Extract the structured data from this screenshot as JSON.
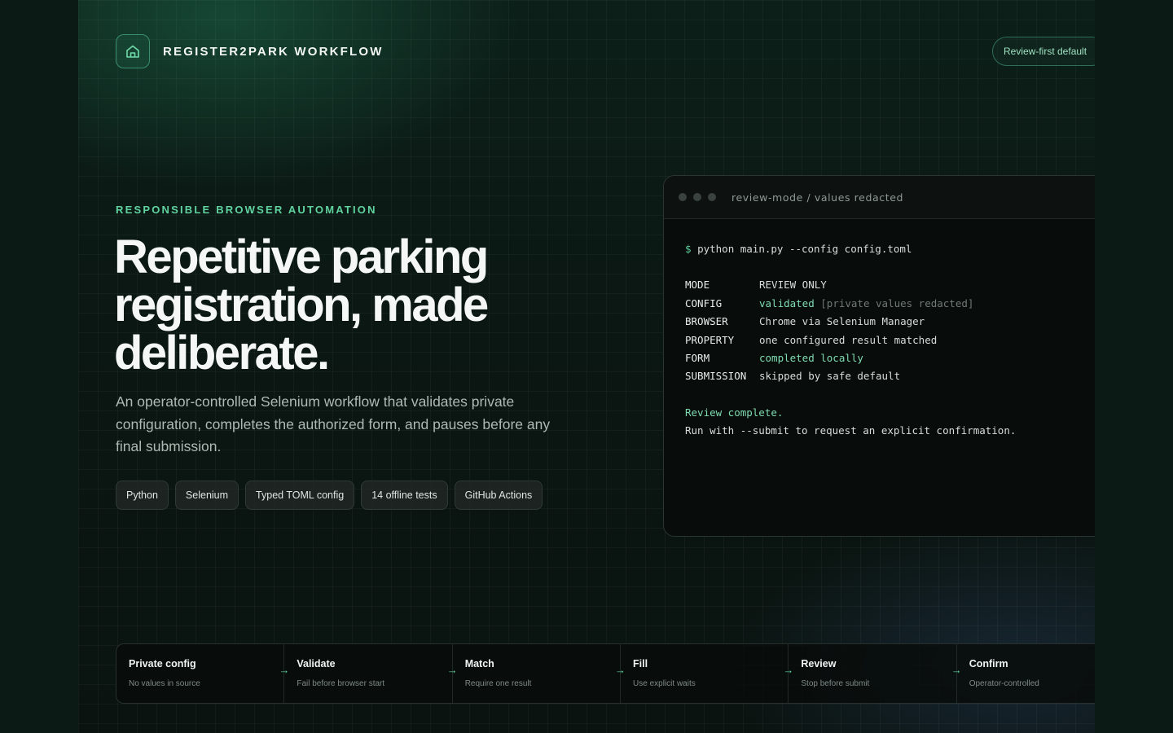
{
  "header": {
    "brand_name": "REGISTER2PARK WORKFLOW",
    "brand_icon": "home-icon",
    "badge": "Review-first default"
  },
  "hero": {
    "eyebrow": "RESPONSIBLE BROWSER AUTOMATION",
    "headline": "Repetitive parking registration, made deliberate.",
    "lede": "An operator-controlled Selenium workflow that validates private configuration, completes the authorized form, and pauses before any final submission.",
    "tags": [
      "Python",
      "Selenium",
      "Typed TOML config",
      "14 offline tests",
      "GitHub Actions"
    ]
  },
  "terminal": {
    "title": "review-mode / values redacted",
    "prompt_symbol": "$",
    "command": "python main.py --config config.toml",
    "rows": [
      {
        "key": "MODE",
        "value": "REVIEW ONLY",
        "extra": ""
      },
      {
        "key": "CONFIG",
        "value": "validated",
        "extra": "[private values redacted]"
      },
      {
        "key": "BROWSER",
        "value": "Chrome via Selenium Manager",
        "extra": ""
      },
      {
        "key": "PROPERTY",
        "value": "one configured result matched",
        "extra": ""
      },
      {
        "key": "FORM",
        "value": "completed locally",
        "extra": ""
      },
      {
        "key": "SUBMISSION",
        "value": "skipped by safe default",
        "extra": ""
      }
    ],
    "summary": "Review complete.",
    "hint": "Run with --submit to request an explicit confirmation."
  },
  "steps": [
    {
      "title": "Private config",
      "sub": "No values in source"
    },
    {
      "title": "Validate",
      "sub": "Fail before browser start"
    },
    {
      "title": "Match",
      "sub": "Require one result"
    },
    {
      "title": "Fill",
      "sub": "Use explicit waits"
    },
    {
      "title": "Review",
      "sub": "Stop before submit"
    },
    {
      "title": "Confirm",
      "sub": "Operator-controlled"
    }
  ],
  "arrow_glyph": "→",
  "colors": {
    "accent": "#5fd3a0",
    "background": "#0a1612",
    "terminal_bg": "#080c0b"
  }
}
